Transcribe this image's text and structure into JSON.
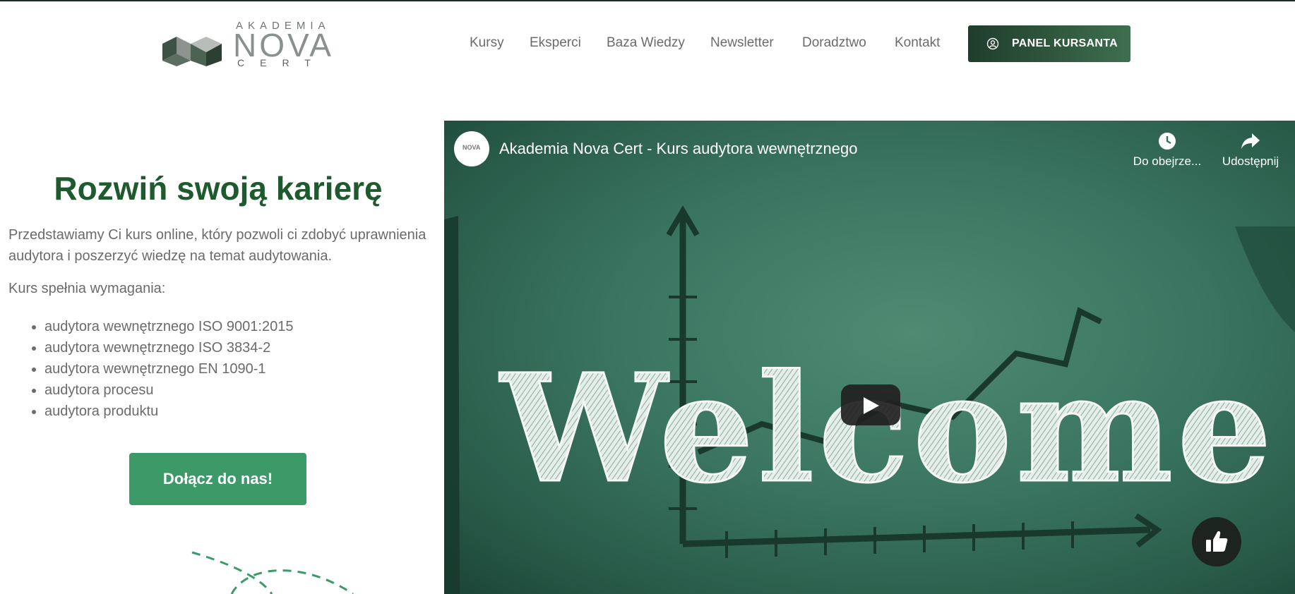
{
  "header": {
    "logo": {
      "top": "AKADEMIA",
      "middle": "NOVA",
      "bottom": "CERT"
    },
    "nav": [
      "Kursy",
      "Eksperci",
      "Baza Wiedzy",
      "Newsletter",
      "Doradztwo",
      "Kontakt"
    ],
    "panel_button": {
      "label": "PANEL KURSANTA",
      "icon": "user-circle-icon"
    }
  },
  "hero": {
    "title": "Rozwiń swoją karierę",
    "intro": "Przedstawiamy Ci kurs online, który pozwoli ci zdobyć uprawnienia audytora i poszerzyć wiedzę na temat audytowania.",
    "requirements_label": "Kurs spełnia wymagania:",
    "requirements": [
      "audytora wewnętrznego ISO 9001:2015",
      "audytora wewnętrznego ISO 3834-2",
      "audytora wewnętrznego EN 1090-1",
      "audytora procesu",
      "audytora produktu"
    ],
    "cta": "Dołącz do nas!"
  },
  "video": {
    "title": "Akademia Nova Cert - Kurs audytora wewnętrznego",
    "channel_badge": "NOVA",
    "watch_later": "Do obejrze...",
    "share": "Udostępnij",
    "board_text": "Welcome",
    "icons": [
      "clock-icon",
      "share-arrow-icon",
      "play-icon",
      "thumbs-up-icon"
    ]
  },
  "colors": {
    "brand_green": "#1f5a2e",
    "cta_green": "#3c9a69",
    "panel_dark": "#1f3d2c",
    "chalkboard": "#3a7561"
  }
}
